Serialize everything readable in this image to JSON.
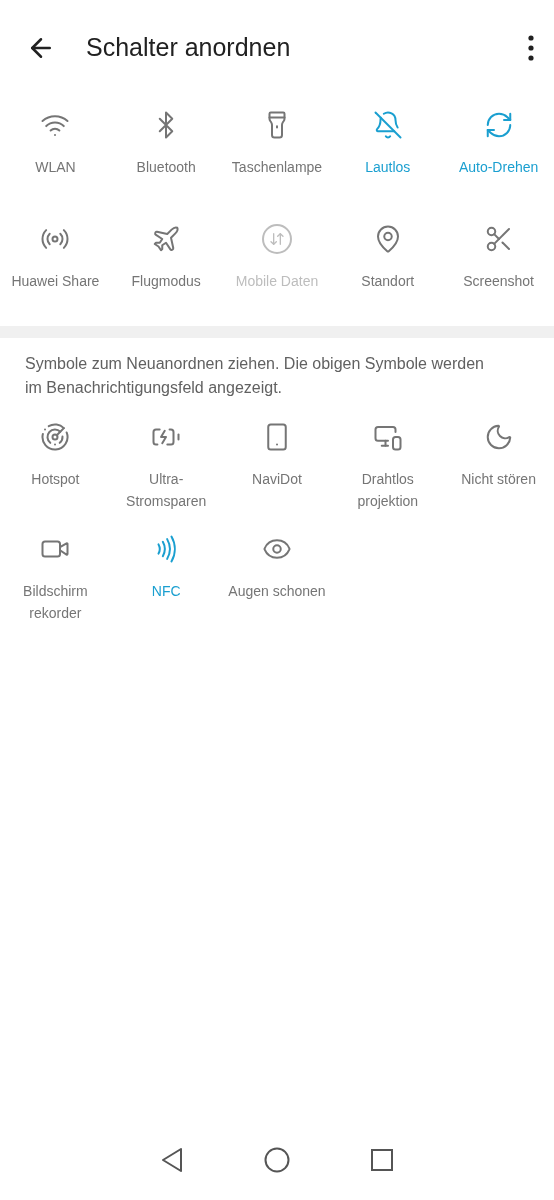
{
  "header": {
    "title": "Schalter anordnen"
  },
  "active_tiles": [
    {
      "label": "WLAN",
      "on": false,
      "disabled": false
    },
    {
      "label": "Bluetooth",
      "on": false,
      "disabled": false
    },
    {
      "label": "Taschenlampe",
      "on": false,
      "disabled": false
    },
    {
      "label": "Lautlos",
      "on": true,
      "disabled": false
    },
    {
      "label": "Auto-Drehen",
      "on": true,
      "disabled": false
    },
    {
      "label": "Huawei Share",
      "on": false,
      "disabled": false
    },
    {
      "label": "Flugmodus",
      "on": false,
      "disabled": false
    },
    {
      "label": "Mobile Daten",
      "on": false,
      "disabled": true
    },
    {
      "label": "Standort",
      "on": false,
      "disabled": false
    },
    {
      "label": "Screenshot",
      "on": false,
      "disabled": false
    }
  ],
  "hint": "Symbole zum Neuanordnen ziehen. Die obigen Symbole werden im Benachrichtigungsfeld angezeigt.",
  "available_tiles": [
    {
      "label": "Hotspot",
      "on": false,
      "disabled": false
    },
    {
      "label": "Ultra-Stromsparen",
      "on": false,
      "disabled": false
    },
    {
      "label": "NaviDot",
      "on": false,
      "disabled": false
    },
    {
      "label": "Drahtlos projektion",
      "on": false,
      "disabled": false
    },
    {
      "label": "Nicht stören",
      "on": false,
      "disabled": false
    },
    {
      "label": "Bildschirm rekorder",
      "on": false,
      "disabled": false
    },
    {
      "label": "NFC",
      "on": true,
      "disabled": false
    },
    {
      "label": "Augen schonen",
      "on": false,
      "disabled": false
    }
  ]
}
